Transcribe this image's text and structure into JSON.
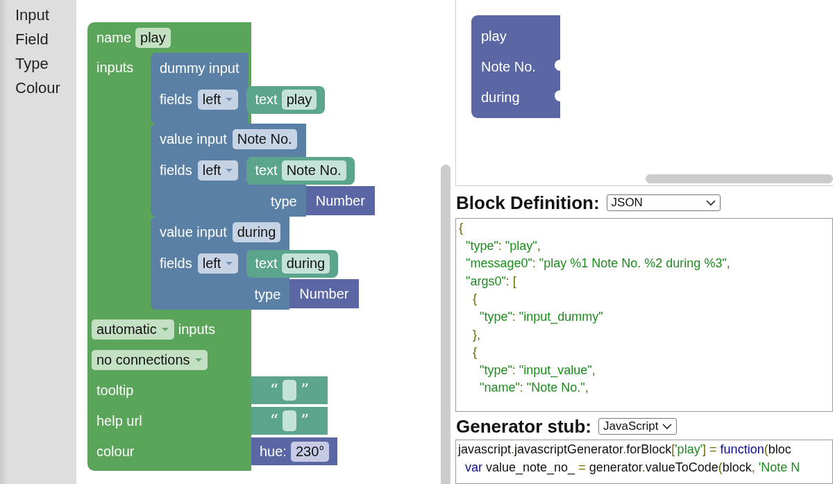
{
  "toolbox": {
    "categories": [
      {
        "label": "Input"
      },
      {
        "label": "Field"
      },
      {
        "label": "Type"
      },
      {
        "label": "Colour"
      }
    ]
  },
  "factory_block": {
    "name_label": "name",
    "name_value": "play",
    "inputs_label": "inputs",
    "inputs": [
      {
        "kind": "dummy",
        "label": "dummy input",
        "fields_label": "fields",
        "align": "left",
        "text_label": "text",
        "text_value": "play"
      },
      {
        "kind": "value",
        "label": "value input",
        "name": "Note No.",
        "fields_label": "fields",
        "align": "left",
        "text_label": "text",
        "text_value": "Note No.",
        "type_label": "type",
        "type_value": "Number"
      },
      {
        "kind": "value",
        "label": "value input",
        "name": "during",
        "fields_label": "fields",
        "align": "left",
        "text_label": "text",
        "text_value": "during",
        "type_label": "type",
        "type_value": "Number"
      }
    ],
    "inputs_mode": "automatic",
    "inputs_mode_suffix": "inputs",
    "connections": "no connections",
    "tooltip": {
      "label": "tooltip",
      "open_quote": "“",
      "close_quote": "”"
    },
    "help_url": {
      "label": "help url",
      "open_quote": "“",
      "close_quote": "”"
    },
    "colour": {
      "label": "colour",
      "hue_label": "hue:",
      "hue_value": "230°"
    }
  },
  "preview_block": {
    "lines": [
      {
        "kind": "dummy",
        "text": "play"
      },
      {
        "kind": "value",
        "text": "Note No."
      },
      {
        "kind": "value",
        "text": "during"
      }
    ]
  },
  "block_definition": {
    "heading": "Block Definition:",
    "format": "JSON",
    "code_lines": [
      [
        {
          "kind": "punct",
          "text": "{"
        }
      ],
      [
        {
          "kind": "str",
          "text": "  \"type\""
        },
        {
          "kind": "punct",
          "text": ": "
        },
        {
          "kind": "str",
          "text": "\"play\""
        },
        {
          "kind": "punct",
          "text": ","
        }
      ],
      [
        {
          "kind": "str",
          "text": "  \"message0\""
        },
        {
          "kind": "punct",
          "text": ": "
        },
        {
          "kind": "str",
          "text": "\"play %1 Note No. %2 during %3\""
        },
        {
          "kind": "punct",
          "text": ","
        }
      ],
      [
        {
          "kind": "str",
          "text": "  \"args0\""
        },
        {
          "kind": "punct",
          "text": ": ["
        }
      ],
      [
        {
          "kind": "punct",
          "text": "    {"
        }
      ],
      [
        {
          "kind": "str",
          "text": "      \"type\""
        },
        {
          "kind": "punct",
          "text": ": "
        },
        {
          "kind": "str",
          "text": "\"input_dummy\""
        }
      ],
      [
        {
          "kind": "punct",
          "text": "    },"
        }
      ],
      [
        {
          "kind": "punct",
          "text": "    {"
        }
      ],
      [
        {
          "kind": "str",
          "text": "      \"type\""
        },
        {
          "kind": "punct",
          "text": ": "
        },
        {
          "kind": "str",
          "text": "\"input_value\""
        },
        {
          "kind": "punct",
          "text": ","
        }
      ],
      [
        {
          "kind": "str",
          "text": "      \"name\""
        },
        {
          "kind": "punct",
          "text": ": "
        },
        {
          "kind": "str",
          "text": "\"Note No.\""
        },
        {
          "kind": "punct",
          "text": ","
        }
      ]
    ]
  },
  "generator_stub": {
    "heading": "Generator stub:",
    "language": "JavaScript",
    "code_lines": [
      [
        {
          "kind": "plain",
          "text": "javascript"
        },
        {
          "kind": "punct",
          "text": "."
        },
        {
          "kind": "plain",
          "text": "javascriptGenerator"
        },
        {
          "kind": "punct",
          "text": "."
        },
        {
          "kind": "plain",
          "text": "forBlock"
        },
        {
          "kind": "punct",
          "text": "["
        },
        {
          "kind": "str",
          "text": "'play'"
        },
        {
          "kind": "punct",
          "text": "] = "
        },
        {
          "kind": "keyword",
          "text": "function"
        },
        {
          "kind": "punct",
          "text": "("
        },
        {
          "kind": "plain",
          "text": "bloc"
        }
      ],
      [
        {
          "kind": "keyword",
          "text": "  var"
        },
        {
          "kind": "plain",
          "text": " value_note_no_ "
        },
        {
          "kind": "punct",
          "text": "="
        },
        {
          "kind": "plain",
          "text": " generator"
        },
        {
          "kind": "punct",
          "text": "."
        },
        {
          "kind": "plain",
          "text": "valueToCode"
        },
        {
          "kind": "punct",
          "text": "("
        },
        {
          "kind": "plain",
          "text": "block"
        },
        {
          "kind": "punct",
          "text": ", "
        },
        {
          "kind": "str",
          "text": "'Note N"
        }
      ]
    ]
  }
}
